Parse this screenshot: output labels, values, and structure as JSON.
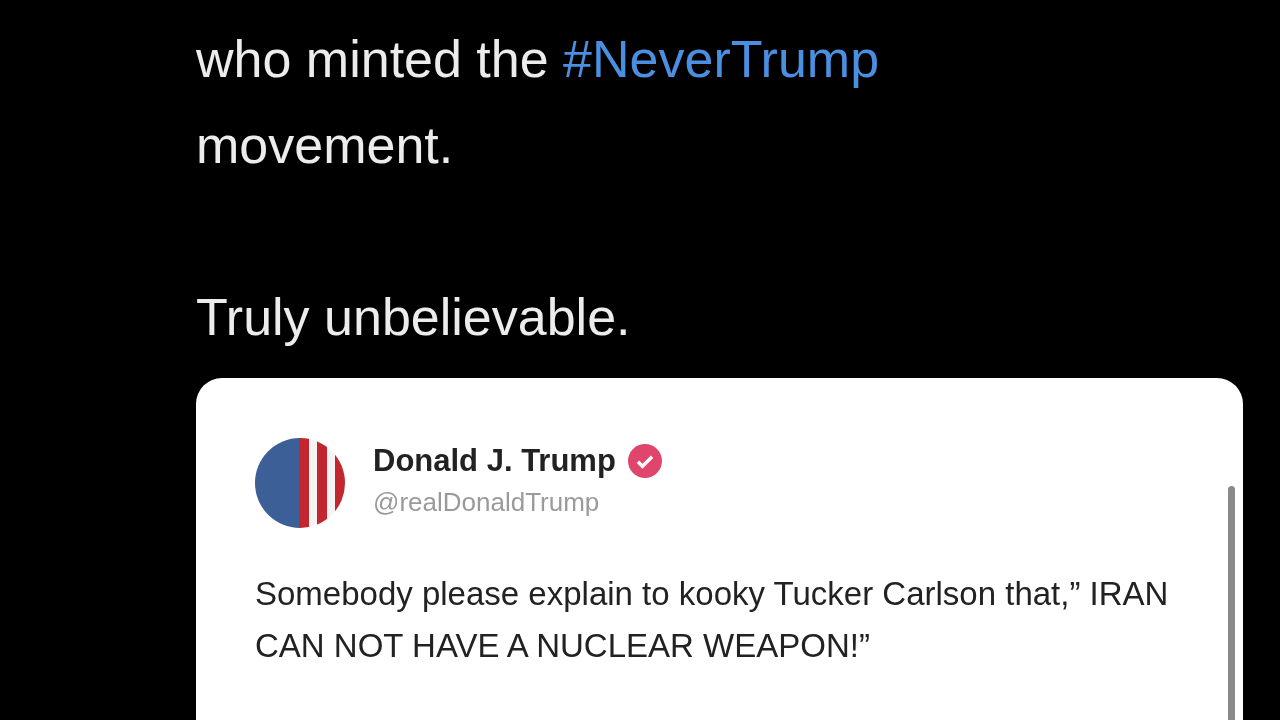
{
  "post": {
    "text_before": "who minted the ",
    "hashtag": "#NeverTrump",
    "text_after": "movement.",
    "closing": "Truly unbelievable."
  },
  "quoted_post": {
    "name": "Donald J. Trump",
    "verified": true,
    "handle": "@realDonaldTrump",
    "text": "Somebody please explain to kooky Tucker Carlson that,” IRAN CAN NOT HAVE A NUCLEAR WEAPON!”"
  }
}
